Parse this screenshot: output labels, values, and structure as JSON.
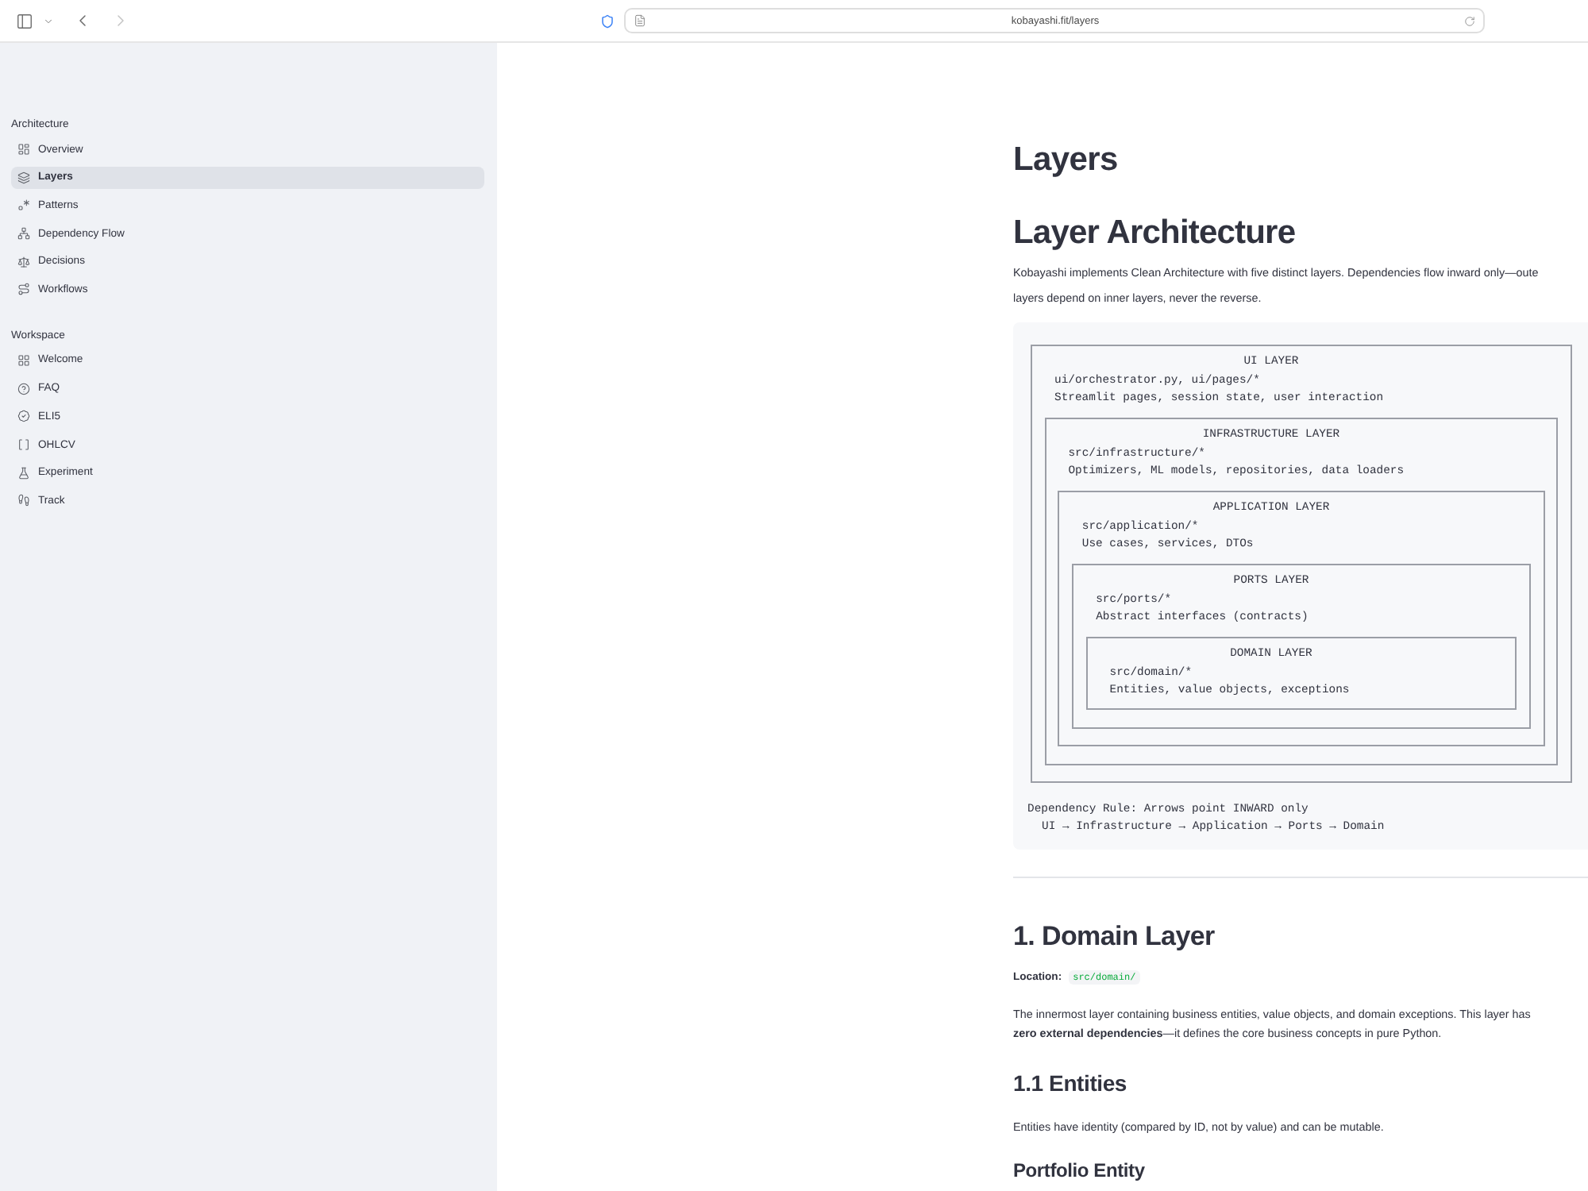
{
  "browser": {
    "url": "kobayashi.fit/layers"
  },
  "sidebar": {
    "sections": [
      {
        "title": "Architecture",
        "items": [
          {
            "label": "Overview",
            "selected": false
          },
          {
            "label": "Layers",
            "selected": true
          },
          {
            "label": "Patterns",
            "selected": false
          },
          {
            "label": "Dependency Flow",
            "selected": false
          },
          {
            "label": "Decisions",
            "selected": false
          },
          {
            "label": "Workflows",
            "selected": false
          }
        ]
      },
      {
        "title": "Workspace",
        "items": [
          {
            "label": "Welcome",
            "selected": false
          },
          {
            "label": "FAQ",
            "selected": false
          },
          {
            "label": "ELI5",
            "selected": false
          },
          {
            "label": "OHLCV",
            "selected": false
          },
          {
            "label": "Experiment",
            "selected": false
          },
          {
            "label": "Track",
            "selected": false
          }
        ]
      }
    ]
  },
  "page": {
    "title": "Layers",
    "heading": "Layer Architecture",
    "intro_lines": [
      "Kobayashi implements Clean Architecture with five distinct layers. Dependencies flow inward only—oute",
      "layers depend on inner layers, never the reverse."
    ],
    "diagram": {
      "layers": [
        {
          "title": "UI LAYER",
          "path": "ui/orchestrator.py, ui/pages/*",
          "description": "Streamlit pages, session state, user interaction",
          "children": [
            {
              "title": "INFRASTRUCTURE LAYER",
              "path": "src/infrastructure/*",
              "description": "Optimizers, ML models, repositories, data loaders",
              "children": [
                {
                  "title": "APPLICATION LAYER",
                  "path": "src/application/*",
                  "description": "Use cases, services, DTOs",
                  "children": [
                    {
                      "title": "PORTS LAYER",
                      "path": "src/ports/*",
                      "description": "Abstract interfaces (contracts)",
                      "children": [
                        {
                          "title": "DOMAIN LAYER",
                          "path": "src/domain/*",
                          "description": "Entities, value objects, exceptions"
                        }
                      ]
                    }
                  ]
                }
              ]
            }
          ]
        }
      ],
      "rule": "Dependency Rule: Arrows point INWARD only",
      "flow": "UI → Infrastructure → Application → Ports → Domain"
    },
    "section": {
      "heading": "1. Domain Layer",
      "location_label": "Location:",
      "location_path": "src/domain/",
      "paragraph_lines": [
        "The innermost layer containing business entities, value objects, and domain exceptions. This layer has",
        "**zero external dependencies**—it defines the core business concepts in pure Python."
      ],
      "subheading": "1.1 Entities",
      "subtext": "Entities have identity (compared by ID, not by value) and can be mutable.",
      "subsubheading": "Portfolio Entity"
    }
  }
}
